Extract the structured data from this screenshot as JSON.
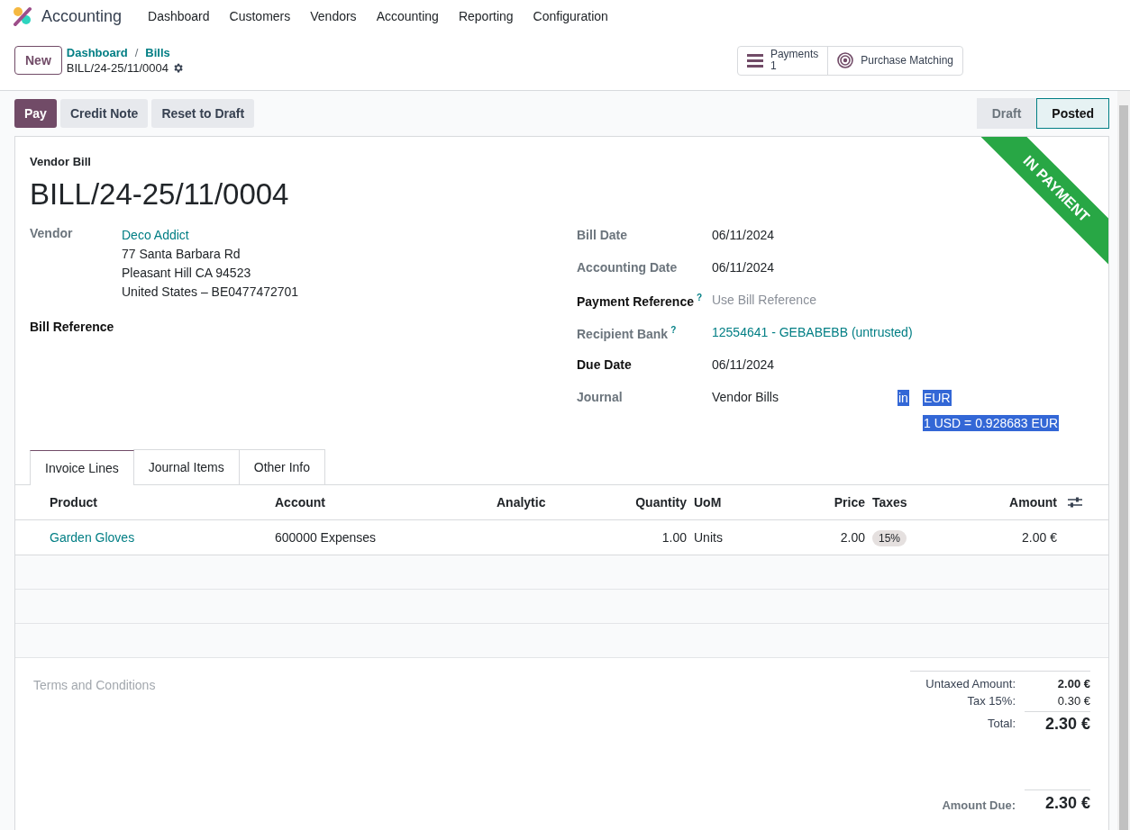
{
  "app": {
    "name": "Accounting"
  },
  "menu": [
    "Dashboard",
    "Customers",
    "Vendors",
    "Accounting",
    "Reporting",
    "Configuration"
  ],
  "control_panel": {
    "new_button": "New",
    "breadcrumbs": [
      "Dashboard",
      "Bills"
    ],
    "breadcrumb_separator": "/",
    "record_name": "BILL/24-25/11/0004",
    "smart_buttons": [
      {
        "kind": "payments",
        "label": "Payments",
        "count": "1"
      },
      {
        "kind": "matching",
        "label": "Purchase Matching"
      }
    ]
  },
  "action_buttons": [
    {
      "label": "Pay",
      "primary": true
    },
    {
      "label": "Credit Note",
      "primary": false
    },
    {
      "label": "Reset to Draft",
      "primary": false
    }
  ],
  "status_steps": [
    {
      "label": "Draft",
      "selected": false
    },
    {
      "label": "Posted",
      "selected": true
    }
  ],
  "sheet": {
    "ribbon": "IN PAYMENT",
    "doc_type": "Vendor Bill",
    "doc_name": "BILL/24-25/11/0004",
    "vendor": {
      "label": "Vendor",
      "name": "Deco Addict",
      "address": [
        "77 Santa Barbara Rd",
        "Pleasant Hill CA 94523",
        "United States – BE0477472701"
      ]
    },
    "bill_reference": {
      "label": "Bill Reference"
    },
    "right_fields": [
      {
        "label": "Bill Date",
        "required": false,
        "value": "06/11/2024",
        "kind": "text"
      },
      {
        "label": "Accounting Date",
        "required": false,
        "value": "06/11/2024",
        "kind": "text"
      },
      {
        "label": "Payment Reference",
        "required": true,
        "help": "?",
        "placeholder": "Use Bill Reference",
        "kind": "input"
      },
      {
        "label": "Recipient Bank",
        "required": false,
        "help": "?",
        "value": "12554641 - GEBABEBB (untrusted)",
        "kind": "link"
      },
      {
        "label": "Due Date",
        "required": true,
        "value": "06/11/2024",
        "kind": "text"
      },
      {
        "label": "Journal",
        "required": false,
        "value": "Vendor Bills",
        "kind": "journal",
        "in_word": {
          "text": "in",
          "selected": true
        },
        "currency": {
          "text": "EUR",
          "selected": true
        },
        "rate": {
          "text": "1 USD = 0.928683 EUR",
          "selected": true
        }
      }
    ]
  },
  "tabs": [
    {
      "label": "Invoice Lines",
      "selected": true
    },
    {
      "label": "Journal Items",
      "selected": false
    },
    {
      "label": "Other Info",
      "selected": false
    }
  ],
  "table": {
    "columns": [
      "Product",
      "Account",
      "Analytic",
      "Quantity",
      "UoM",
      "Price",
      "Taxes",
      "Amount"
    ],
    "rows": [
      {
        "product": "Garden Gloves",
        "account": "600000 Expenses",
        "quantity": "1.00",
        "uom": "Units",
        "price": "2.00",
        "taxes": [
          "15%"
        ],
        "amount": "2.00 €"
      }
    ]
  },
  "terms": {
    "placeholder": "Terms and Conditions"
  },
  "totals": [
    {
      "label": "Untaxed Amount:",
      "value": "2.00 €",
      "kind": "subtotal"
    },
    {
      "label": "Tax 15%:",
      "value": "0.30 €",
      "kind": "tax"
    },
    {
      "label": "Total:",
      "value": "2.30 €",
      "kind": "total"
    },
    {
      "label": "Amount Due:",
      "value": "2.30 €",
      "kind": "due"
    }
  ]
}
